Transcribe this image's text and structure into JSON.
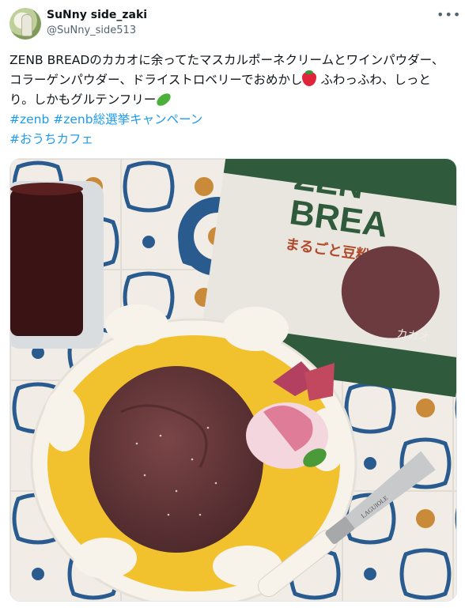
{
  "tweet": {
    "display_name": "SuNny side_zaki",
    "handle": "@SuNny_side513",
    "more_icon": "more-icon",
    "text_part1": "ZENB BREADのカカオに余ってたマスカルポーネクリームとワインパウダー、コラーゲンパウダー、ドライストロベリーでおめかし",
    "text_part2": "ふわっふわ、しっとり。しかもグルテンフリー",
    "emoji_1": "strawberry-emoji",
    "emoji_2": "pea-pod-emoji",
    "hashtags": [
      "#zenb #zenb総選挙キャンペーン",
      "#おうちカフェ"
    ]
  },
  "photo": {
    "package_line1": "ZEN",
    "package_line2": "BREA",
    "package_subtitle": "まるごと豆粉パン",
    "package_flavor": "カカオ",
    "knife_text": "LAGUIOLE"
  },
  "colors": {
    "link": "#1d9bf0",
    "plate_yellow": "#f2c12e",
    "cake": "#6b3b3f",
    "package_green": "#2f5a3c"
  }
}
